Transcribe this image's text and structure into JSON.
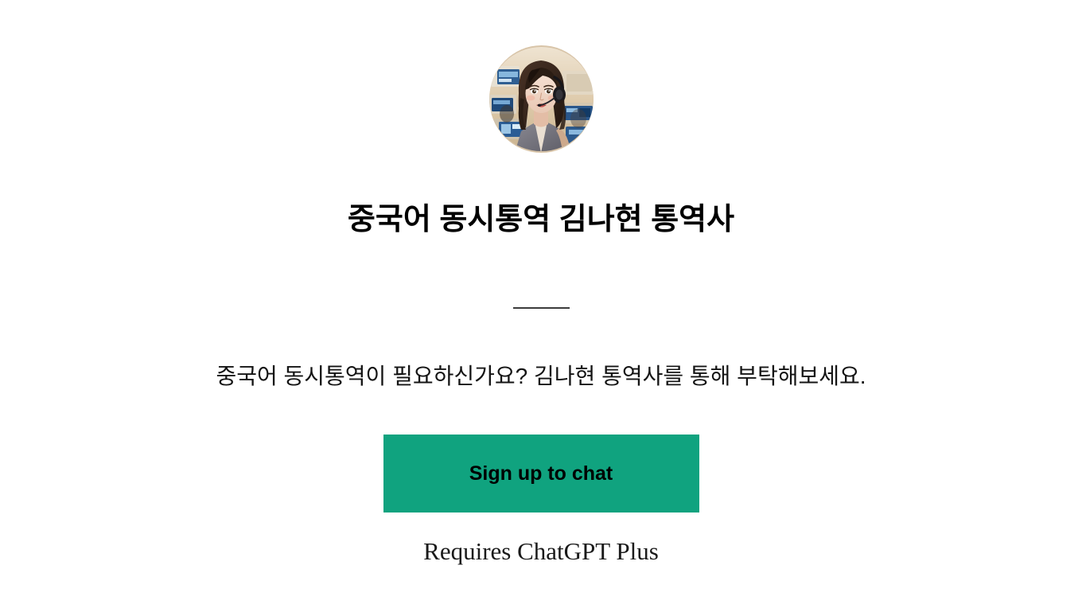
{
  "page": {
    "background_color": "#ffffff"
  },
  "gpt_profile": {
    "avatar": {
      "icon": "avatar-image-interpreter-woman-headset",
      "alt": "Female Chinese interpreter wearing a headset in a call center"
    },
    "title": "중국어 동시통역 김나현 통역사",
    "divider": "divider-rule",
    "description": "중국어 동시통역이 필요하신가요? 김나현 통역사를 통해 부탁해보세요."
  },
  "cta": {
    "label": "Sign up to chat",
    "background_color": "#10a37f",
    "text_color": "#000000"
  },
  "footer": {
    "requires_note": "Requires ChatGPT Plus"
  }
}
